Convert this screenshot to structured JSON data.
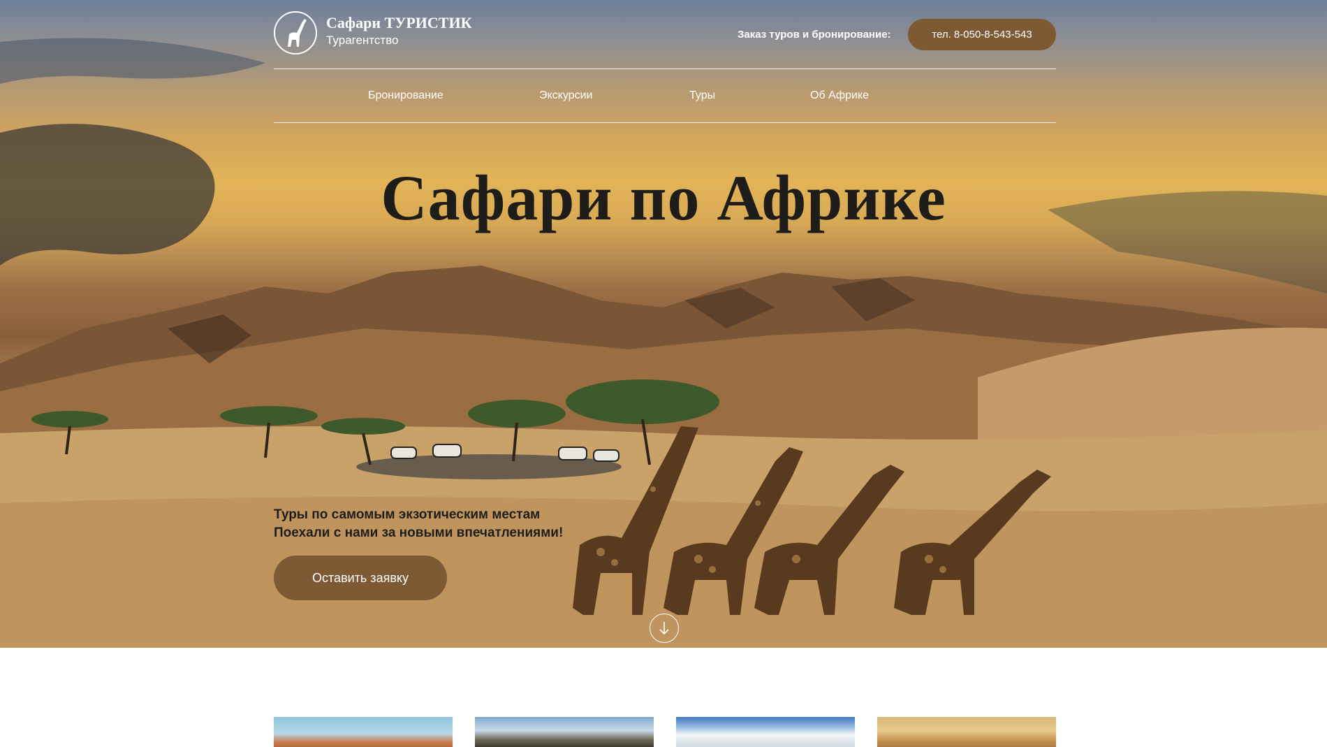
{
  "header": {
    "brand_title": "Сафари ТУРИСТИК",
    "brand_subtitle": "Турагентство",
    "order_label": "Заказ туров и бронирование:",
    "phone_button": "тел. 8-050-8-543-543",
    "logo_icon": "giraffe-icon"
  },
  "nav": {
    "items": [
      "Бронирование",
      "Экскурсии",
      "Туры",
      "Об Африке"
    ]
  },
  "hero": {
    "title": "Сафари по Африке",
    "tagline_1": "Туры по самомым экзотическим местам",
    "tagline_2": "Поехали с нами за новыми впечатлениями!",
    "cta_label": "Оставить заявку",
    "scroll_icon": "arrow-down-circle-icon"
  },
  "colors": {
    "accent_brown": "#7d5a34",
    "title_text": "#1f1d1a",
    "header_text": "#ffffff"
  }
}
